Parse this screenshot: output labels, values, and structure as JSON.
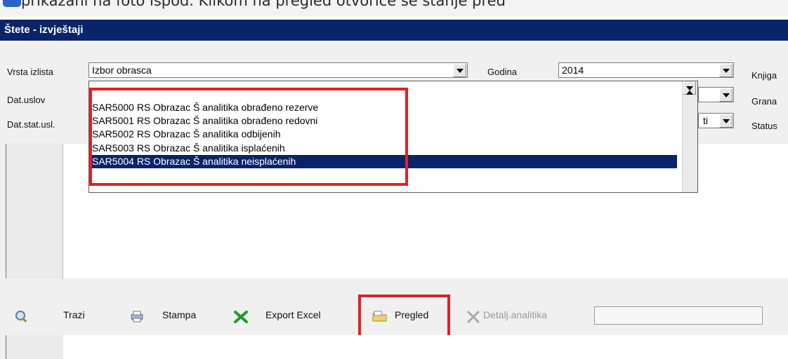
{
  "top": {
    "caption": "prikazani na foto ispod. Klikom na pregled otvoriće se stanje pred"
  },
  "window": {
    "title": "Štete - izvještaji"
  },
  "filters": {
    "vrsta_label": "Vrsta izlista",
    "vrsta_value": "Izbor obrasca",
    "godina_label": "Godina",
    "godina_value": "2014",
    "knjiga_label": "Knjiga",
    "dat_uslov_label": "Dat.uslov",
    "grana_label": "Grana",
    "dat_stat_label": "Dat.stat.usl.",
    "dat_stat_value": "ti",
    "status_label": "Status"
  },
  "dropdown": {
    "options": [
      "SAR5000 RS Obrazac Š analitika obrađeno rezerve",
      "SAR5001 RS Obrazac Š analitika obrađeno redovni",
      "SAR5002 RS Obrazac Š analitika odbijenih",
      "SAR5003 RS Obrazac Š analitika isplaćenih",
      "SAR5004 RS Obrazac Š analitika neisplaćenih"
    ],
    "selected_index": 4
  },
  "toolbar": {
    "trazi": "Trazi",
    "stampa": "Stampa",
    "export": "Export Excel",
    "pregled": "Pregled",
    "detalj": "Detalj.analitika"
  },
  "colors": {
    "title_bar": "#0a246a",
    "selection": "#0a246a",
    "highlight_red": "#e0202a",
    "export_green": "#1f9a2e"
  }
}
